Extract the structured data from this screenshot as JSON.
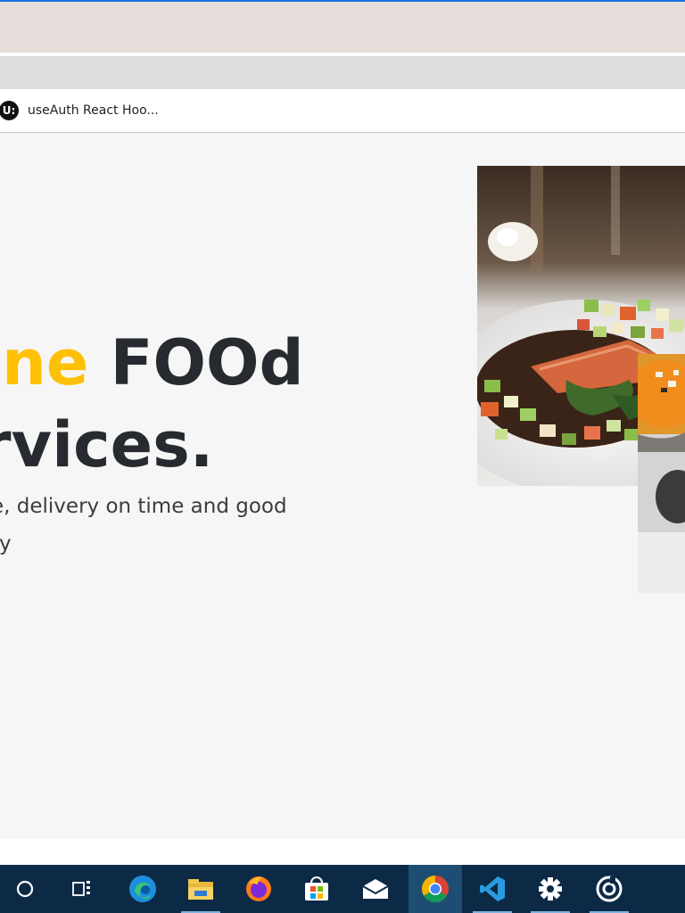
{
  "browser": {
    "bookmarks": [
      {
        "favicon_text": "U:",
        "label": "useAuth React Hoo..."
      }
    ]
  },
  "hero": {
    "title_line1_accent": "ine",
    "title_line1_rest": " FOOd",
    "title_line2": "rvices.",
    "subtitle_line1": "e, delivery on time and good",
    "subtitle_line2": "ty"
  },
  "images": {
    "main": "plated salmon dish with vegetables",
    "secondary": "bowl of orange soup"
  },
  "taskbar": {
    "items": [
      {
        "name": "search-icon"
      },
      {
        "name": "task-view-icon"
      },
      {
        "name": "edge-icon"
      },
      {
        "name": "file-explorer-icon"
      },
      {
        "name": "firefox-icon"
      },
      {
        "name": "store-icon"
      },
      {
        "name": "mail-icon"
      },
      {
        "name": "chrome-icon"
      },
      {
        "name": "vscode-icon"
      },
      {
        "name": "settings-icon"
      },
      {
        "name": "app-icon"
      }
    ]
  },
  "colors": {
    "accent": "#ffc107",
    "text_dark": "#272b2f",
    "taskbar": "#0c2a46",
    "taskbar_active": "#1e4d74"
  }
}
